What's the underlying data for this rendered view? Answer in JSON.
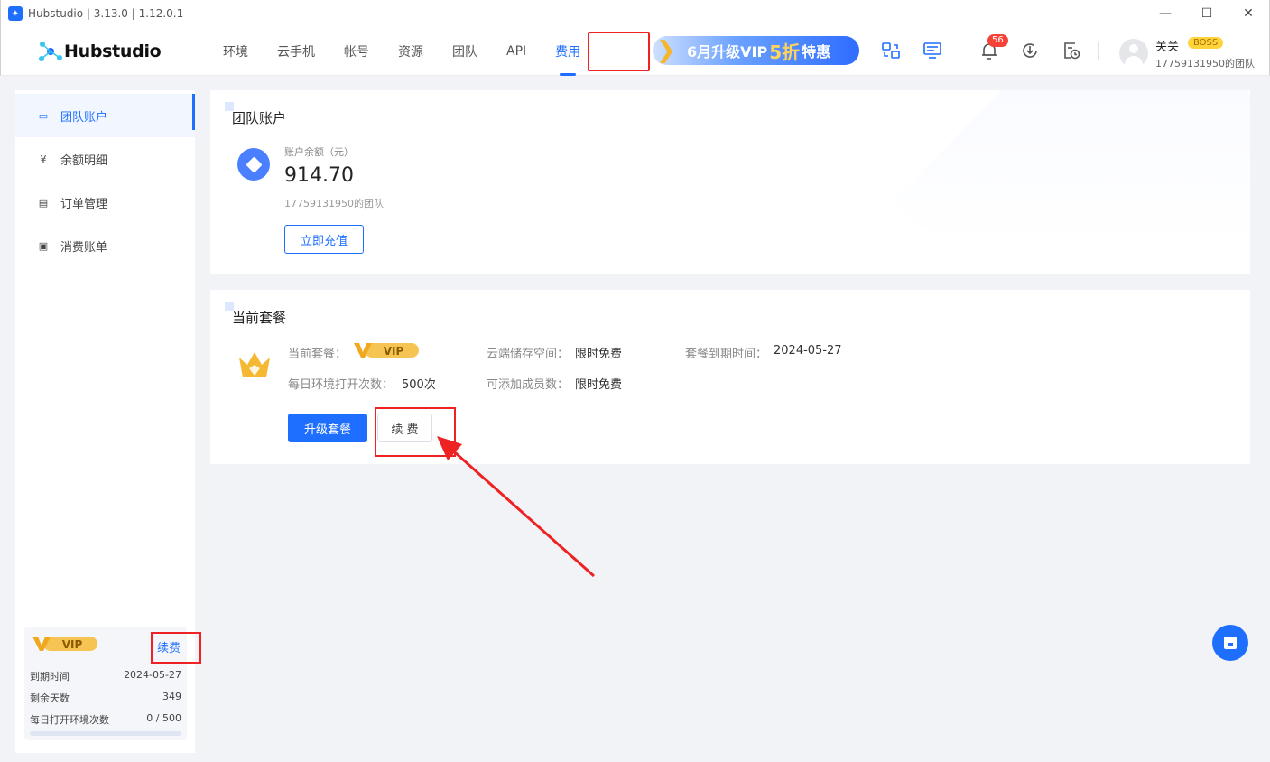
{
  "window": {
    "title": "Hubstudio | 3.13.0 | 1.12.0.1",
    "minimize": "—",
    "maximize": "☐",
    "close": "✕"
  },
  "logo": {
    "text": "Hubstudio"
  },
  "nav": {
    "items": [
      {
        "label": "环境",
        "active": false
      },
      {
        "label": "云手机",
        "active": false
      },
      {
        "label": "帐号",
        "active": false
      },
      {
        "label": "资源",
        "active": false
      },
      {
        "label": "团队",
        "active": false
      },
      {
        "label": "API",
        "active": false
      },
      {
        "label": "费用",
        "active": true
      }
    ]
  },
  "promo": {
    "part1": "6月升级VIP",
    "big": "5折",
    "part2": "特惠"
  },
  "notifications": {
    "count": "56"
  },
  "user": {
    "name": "关关",
    "role": "BOSS",
    "team": "17759131950的团队"
  },
  "sidebar": {
    "items": [
      {
        "label": "团队账户",
        "icon": "wallet-icon",
        "glyph": "▭"
      },
      {
        "label": "余额明细",
        "icon": "yen-icon",
        "glyph": "¥"
      },
      {
        "label": "订单管理",
        "icon": "clipboard-icon",
        "glyph": "▤"
      },
      {
        "label": "消费账单",
        "icon": "bill-icon",
        "glyph": "▣"
      }
    ],
    "vip": {
      "renew": "续费",
      "rows": [
        {
          "label": "到期时间",
          "value": "2024-05-27"
        },
        {
          "label": "剩余天数",
          "value": "349"
        },
        {
          "label": "每日打开环境次数",
          "value": "0 / 500"
        }
      ]
    }
  },
  "account": {
    "title": "团队账户",
    "balance_label": "账户余额（元）",
    "balance": "914.70",
    "team": "17759131950的团队",
    "recharge": "立即充值"
  },
  "plan": {
    "title": "当前套餐",
    "current_label": "当前套餐：",
    "vip": "VIP",
    "storage_label": "云端储存空间：",
    "storage_value": "限时免费",
    "expire_label": "套餐到期时间：",
    "expire_value": "2024-05-27",
    "daily_label": "每日环境打开次数：",
    "daily_value": "500次",
    "members_label": "可添加成员数：",
    "members_value": "限时免费",
    "upgrade": "升级套餐",
    "renew": "续 费"
  },
  "colors": {
    "accent": "#1e6fff",
    "highlight": "#ee2222",
    "gold": "#f5b833"
  }
}
